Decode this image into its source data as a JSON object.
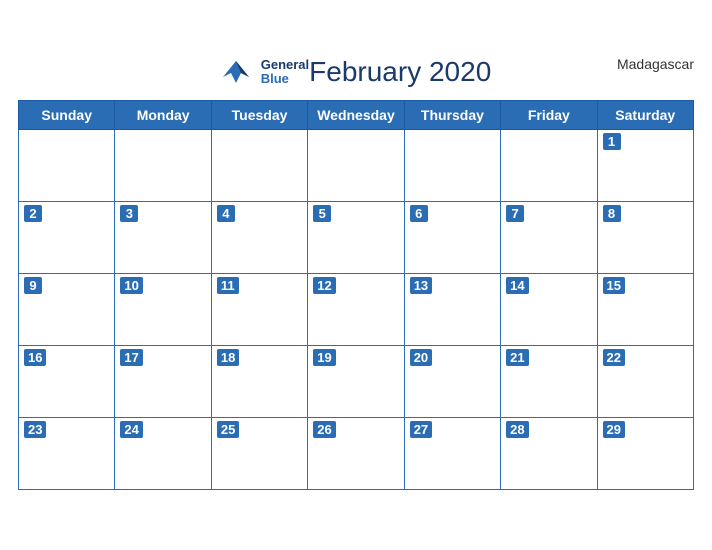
{
  "header": {
    "title": "February 2020",
    "country": "Madagascar",
    "logo": {
      "general": "General",
      "blue": "Blue"
    }
  },
  "weekdays": [
    "Sunday",
    "Monday",
    "Tuesday",
    "Wednesday",
    "Thursday",
    "Friday",
    "Saturday"
  ],
  "weeks": [
    [
      null,
      null,
      null,
      null,
      null,
      null,
      1
    ],
    [
      2,
      3,
      4,
      5,
      6,
      7,
      8
    ],
    [
      9,
      10,
      11,
      12,
      13,
      14,
      15
    ],
    [
      16,
      17,
      18,
      19,
      20,
      21,
      22
    ],
    [
      23,
      24,
      25,
      26,
      27,
      28,
      29
    ]
  ]
}
